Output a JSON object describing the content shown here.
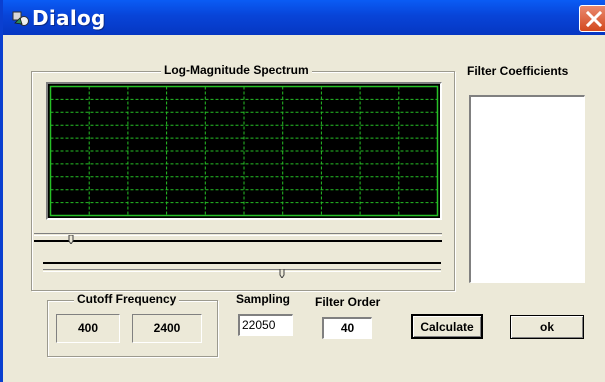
{
  "window": {
    "title": "Dialog"
  },
  "spectrum": {
    "label": "Log-Magnitude Spectrum",
    "grid_color": "#26c026",
    "background": "#000000",
    "scroll1_position": 0.09,
    "scroll2_position": 0.6
  },
  "coefficients": {
    "label": "Filter Coefficients",
    "items": []
  },
  "cutoff": {
    "label": "Cutoff Frequency",
    "low": "400",
    "high": "2400"
  },
  "sampling": {
    "label": "Sampling",
    "value": "22050"
  },
  "filter_order": {
    "label": "Filter Order",
    "value": "40"
  },
  "buttons": {
    "calculate": "Calculate",
    "ok": "ok"
  },
  "colors": {
    "titlebar": "#0a4fe6",
    "close": "#d3491f",
    "face": "#ece9d8"
  }
}
